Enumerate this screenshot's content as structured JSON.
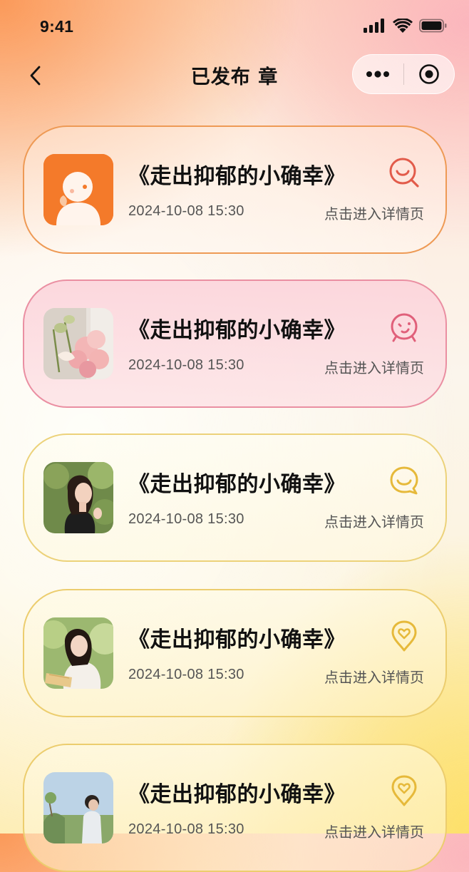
{
  "status_bar": {
    "time": "9:41"
  },
  "nav": {
    "title": "已发布 章"
  },
  "colors": {
    "orange": "#f07b2e",
    "pink": "#e0607a",
    "gold": "#e6b93a",
    "text": "#111111",
    "subtext": "#555555"
  },
  "articles": [
    {
      "title": "《走出抑郁的小确幸》",
      "date": "2024-10-08 15:30",
      "link_text": "点击进入详情页",
      "icon": "smile-search-icon",
      "thumbnail": "avatar-illustration"
    },
    {
      "title": "《走出抑郁的小确幸》",
      "date": "2024-10-08 15:30",
      "link_text": "点击进入详情页",
      "icon": "alarm-clock-face-icon",
      "thumbnail": "flowers-photo"
    },
    {
      "title": "《走出抑郁的小确幸》",
      "date": "2024-10-08 15:30",
      "link_text": "点击进入详情页",
      "icon": "chat-smile-icon",
      "thumbnail": "woman-portrait-photo"
    },
    {
      "title": "《走出抑郁的小确幸》",
      "date": "2024-10-08 15:30",
      "link_text": "点击进入详情页",
      "icon": "heart-location-pin-icon",
      "thumbnail": "woman-reading-photo"
    },
    {
      "title": "《走出抑郁的小确幸》",
      "date": "2024-10-08 15:30",
      "link_text": "点击进入详情页",
      "icon": "heart-location-pin-icon",
      "thumbnail": "man-outdoors-photo"
    }
  ]
}
